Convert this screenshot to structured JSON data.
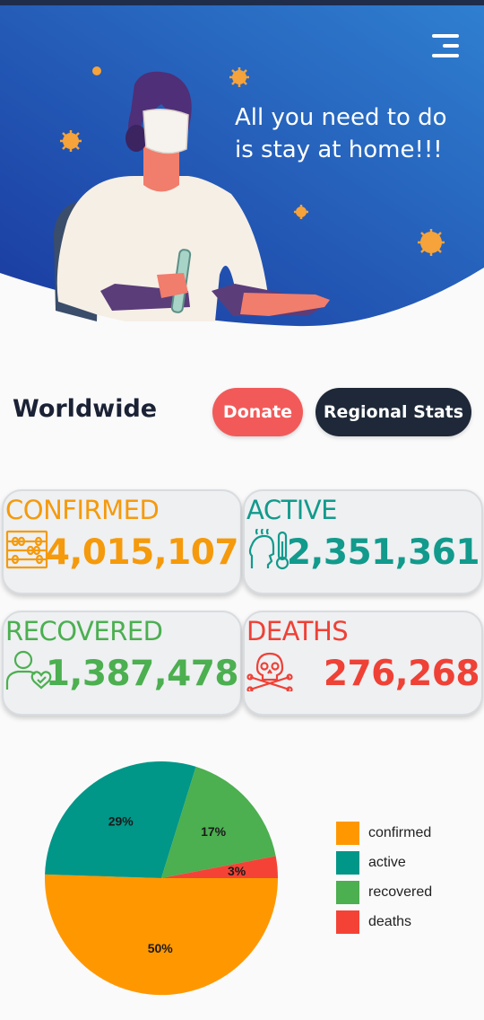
{
  "hero": {
    "tagline_line1": "All you need to do",
    "tagline_line2": "is stay at home!!!",
    "gradient_start": "#1a3aa0",
    "gradient_end": "#2f7fd0"
  },
  "header": {
    "menu_icon": "menu-icon"
  },
  "section": {
    "title": "Worldwide",
    "donate_label": "Donate",
    "regional_label": "Regional Stats"
  },
  "stats": [
    {
      "key": "confirmed",
      "label": "CONFIRMED",
      "value": "4,015,107",
      "color": "#f59a0c",
      "icon": "abacus-icon"
    },
    {
      "key": "active",
      "label": "ACTIVE",
      "value": "2,351,361",
      "color": "#129a8c",
      "icon": "fever-thermometer-icon"
    },
    {
      "key": "recovered",
      "label": "RECOVERED",
      "value": "1,387,478",
      "color": "#4caf50",
      "icon": "recovered-person-icon"
    },
    {
      "key": "deaths",
      "label": "DEATHS",
      "value": "276,268",
      "color": "#ef4136",
      "icon": "skull-crossbones-icon"
    }
  ],
  "chart_data": {
    "type": "pie",
    "slices": [
      {
        "name": "confirmed",
        "value": 50,
        "label": "50%",
        "color": "#ff9800"
      },
      {
        "name": "active",
        "value": 29,
        "label": "29%",
        "color": "#009688"
      },
      {
        "name": "recovered",
        "value": 17,
        "label": "17%",
        "color": "#4caf50"
      },
      {
        "name": "deaths",
        "value": 3,
        "label": "3%",
        "color": "#f44336"
      }
    ],
    "legend_position": "right"
  }
}
